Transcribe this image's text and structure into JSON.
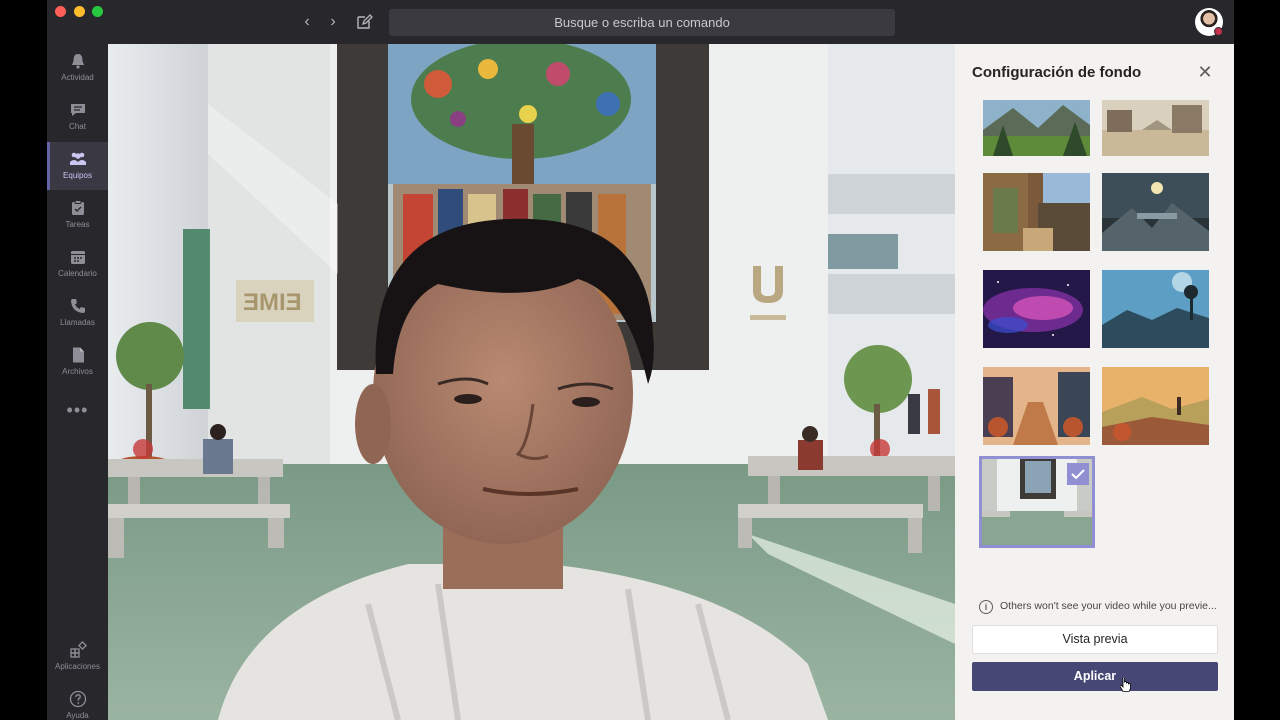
{
  "titlebar": {
    "search_placeholder": "Busque o escriba un comando"
  },
  "rail": {
    "items": [
      {
        "label": "Actividad",
        "icon": "bell-icon"
      },
      {
        "label": "Chat",
        "icon": "chat-icon"
      },
      {
        "label": "Equipos",
        "icon": "teams-icon",
        "active": true
      },
      {
        "label": "Tareas",
        "icon": "tasks-icon"
      },
      {
        "label": "Calendario",
        "icon": "calendar-icon"
      },
      {
        "label": "Llamadas",
        "icon": "phone-icon"
      },
      {
        "label": "Archivos",
        "icon": "file-icon"
      }
    ],
    "more": "•••",
    "bottom": [
      {
        "label": "Aplicaciones",
        "icon": "apps-icon"
      },
      {
        "label": "Ayuda",
        "icon": "help-icon"
      }
    ]
  },
  "panel": {
    "title": "Configuración de fondo",
    "info": "Others won't see your video while you previe...",
    "preview_button": "Vista previa",
    "apply_button": "Aplicar"
  },
  "colors": {
    "accent": "#6264a7",
    "apply": "#464775",
    "selected_border": "#8f8fd1",
    "rail_bg": "#28272c"
  }
}
